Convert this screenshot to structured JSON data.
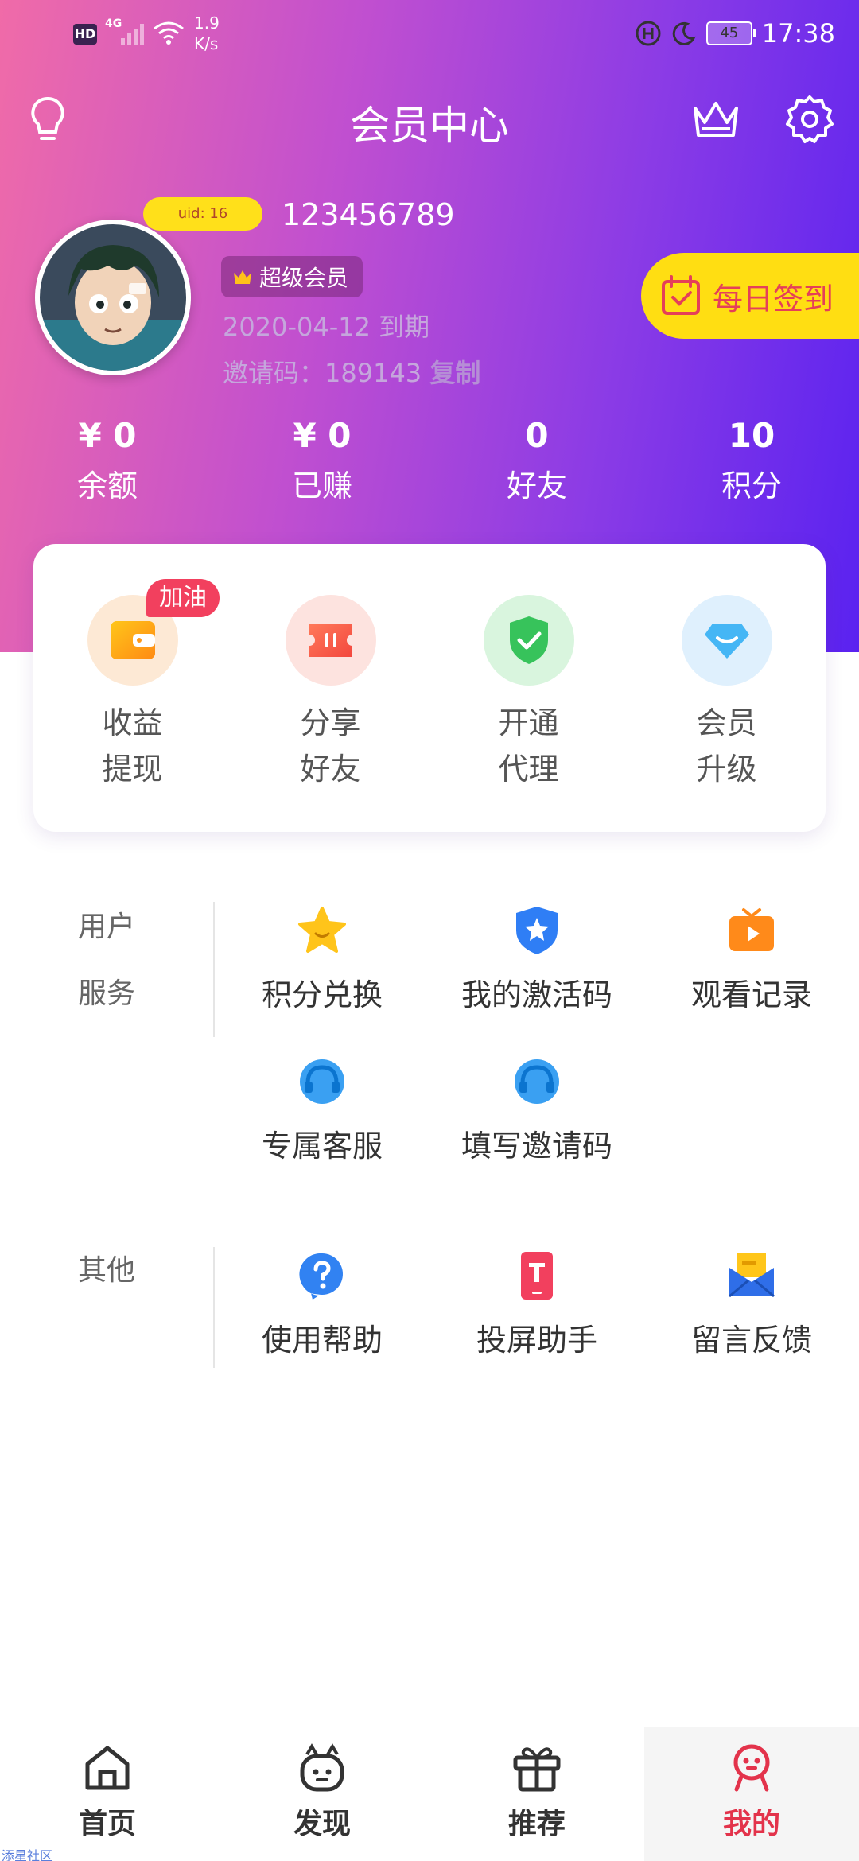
{
  "status_bar": {
    "hd": "HD",
    "network": "4G",
    "speed_value": "1.9",
    "speed_unit": "K/s",
    "battery": "45",
    "time": "17:38"
  },
  "header": {
    "title": "会员中心",
    "icons": [
      "bulb-icon",
      "crown-icon",
      "gear-icon"
    ]
  },
  "profile": {
    "uid_label": "uid: 16",
    "username": "123456789",
    "vip_label": "超级会员",
    "expire_date": "2020-04-12 到期",
    "invite_label": "邀请码：189143",
    "copy_label": "复制",
    "signin_label": "每日签到"
  },
  "stats": [
    {
      "value": "¥ 0",
      "label": "余额"
    },
    {
      "value": "¥ 0",
      "label": "已赚"
    },
    {
      "value": "0",
      "label": "好友"
    },
    {
      "value": "10",
      "label": "积分"
    }
  ],
  "actions": [
    {
      "line1": "收益",
      "line2": "提现",
      "badge": "加油",
      "icon": "wallet-icon"
    },
    {
      "line1": "分享",
      "line2": "好友",
      "icon": "ticket-icon"
    },
    {
      "line1": "开通",
      "line2": "代理",
      "icon": "shield-check-icon"
    },
    {
      "line1": "会员",
      "line2": "升级",
      "icon": "diamond-icon"
    }
  ],
  "user_service": {
    "title_line1": "用户",
    "title_line2": "服务",
    "items": [
      {
        "label": "积分兑换",
        "icon": "star-icon"
      },
      {
        "label": "我的激活码",
        "icon": "star-shield-icon"
      },
      {
        "label": "观看记录",
        "icon": "tv-play-icon"
      },
      {
        "label": "专属客服",
        "icon": "headset-icon"
      },
      {
        "label": "填写邀请码",
        "icon": "headset-icon"
      }
    ]
  },
  "other": {
    "title": "其他",
    "items": [
      {
        "label": "使用帮助",
        "icon": "help-icon"
      },
      {
        "label": "投屏助手",
        "icon": "cast-icon"
      },
      {
        "label": "留言反馈",
        "icon": "envelope-icon"
      }
    ]
  },
  "bottom_nav": [
    {
      "label": "首页",
      "icon": "home-icon"
    },
    {
      "label": "发现",
      "icon": "discover-icon"
    },
    {
      "label": "推荐",
      "icon": "gift-icon"
    },
    {
      "label": "我的",
      "icon": "profile-icon",
      "active": true
    }
  ],
  "watermark": "添星社区",
  "colors": {
    "gradient_start": "#f06ba8",
    "gradient_end": "#5a22f0",
    "signin_bg": "#ffde12",
    "accent_red": "#e3334b",
    "uid_bg": "#ffe01a"
  }
}
